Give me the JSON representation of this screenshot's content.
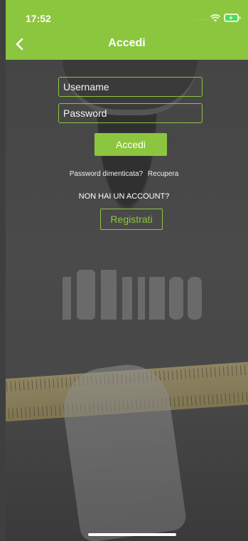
{
  "status_bar": {
    "time": "17:52",
    "signal": "....."
  },
  "header": {
    "title": "Accedi"
  },
  "form": {
    "username_placeholder": "Username",
    "password_placeholder": "Password",
    "login_label": "Accedi",
    "forgot_text": "Password dimenticata?",
    "recover_link": "Recupera",
    "no_account_text": "NON HAI UN ACCOUNT?",
    "register_label": "Registrati"
  },
  "colors": {
    "accent": "#8cc63f",
    "background": "#3f3f3f"
  },
  "icons": [
    "chevron-left-icon",
    "wifi-icon",
    "battery-charging-icon",
    "logo-watermark"
  ]
}
